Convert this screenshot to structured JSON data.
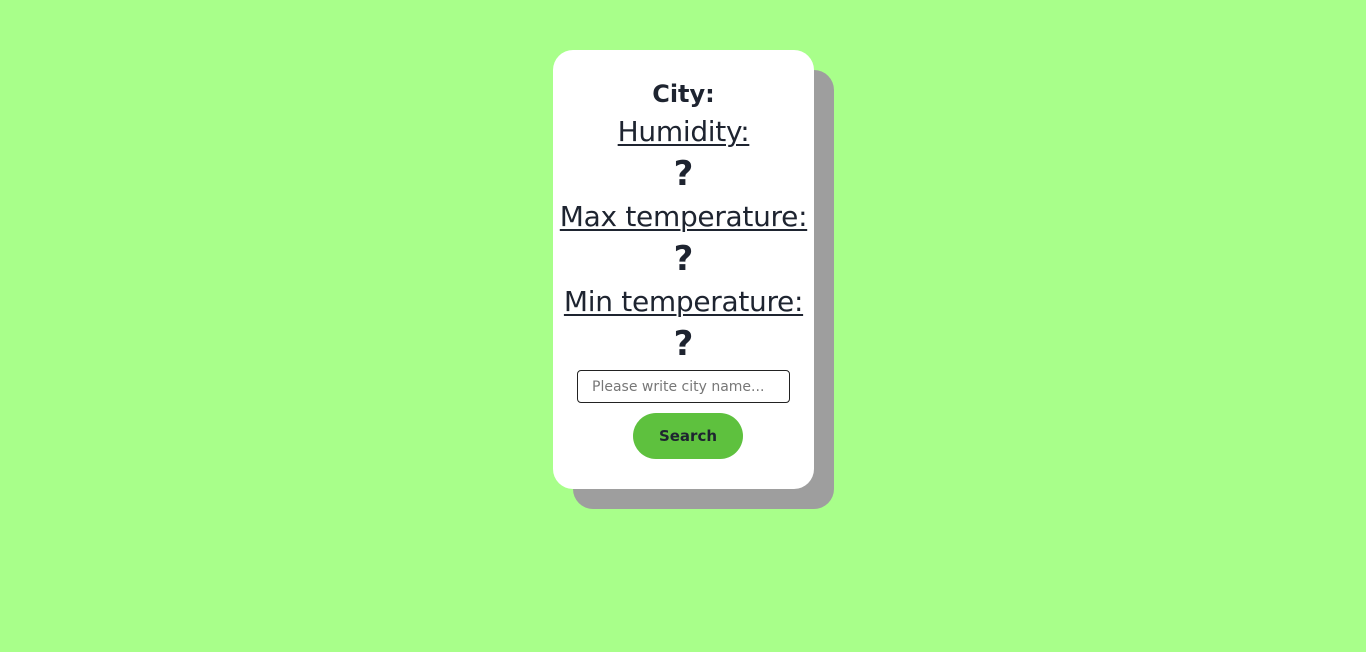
{
  "weather_card": {
    "city_label": "City:",
    "humidity_label": "Humidity:",
    "humidity_value": "?",
    "max_temp_label": "Max temperature:",
    "max_temp_value": "?",
    "min_temp_label": "Min temperature:",
    "min_temp_value": "?"
  },
  "search": {
    "value": "",
    "placeholder": "Please write city name...",
    "button_label": "Search"
  },
  "colors": {
    "background": "#a8ff8a",
    "card": "#ffffff",
    "card_shadow": "#9e9e9e",
    "button": "#5ec13e",
    "text": "#1e2430"
  }
}
